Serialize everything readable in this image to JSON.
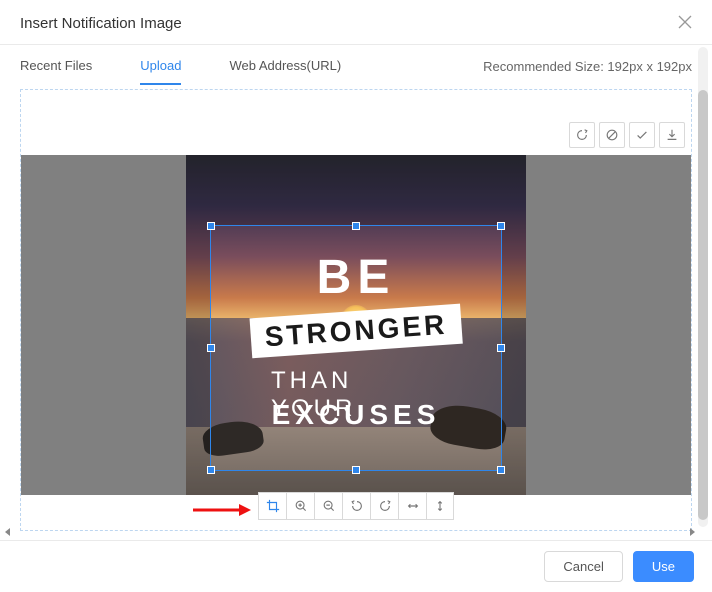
{
  "dialog": {
    "title": "Insert Notification Image"
  },
  "tabs": {
    "recent": "Recent Files",
    "upload": "Upload",
    "web": "Web Address(URL)",
    "recommended": "Recommended Size: 192px x 192px"
  },
  "image": {
    "text_be": "BE",
    "text_stronger": "STRONGER",
    "text_than": "THAN YOUR",
    "text_excuses": "EXCUSES"
  },
  "footer": {
    "cancel": "Cancel",
    "use": "Use"
  },
  "colors": {
    "accent": "#2f86eb",
    "primary_btn": "#3b8cff"
  }
}
